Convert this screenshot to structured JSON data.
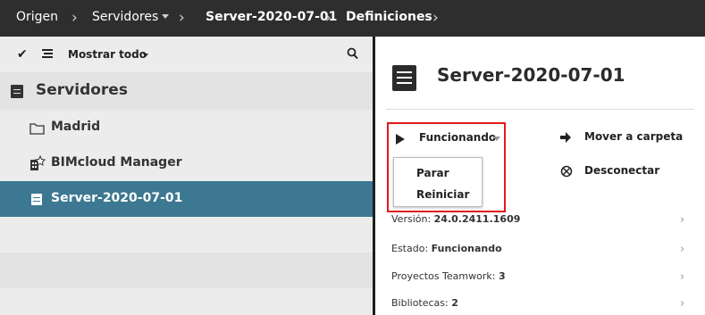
{
  "breadcrumb": {
    "items": [
      {
        "label": "Origen"
      },
      {
        "label": "Servidores"
      },
      {
        "label": "Server-2020-07-01"
      },
      {
        "label": "Definiciones"
      }
    ]
  },
  "sidebar": {
    "toolbar": {
      "filter_label": "Mostrar todo"
    },
    "group_title": "Servidores",
    "items": [
      {
        "label": "Madrid",
        "icon": "folder-icon"
      },
      {
        "label": "BIMcloud Manager",
        "icon": "bimcloud-manager-icon"
      },
      {
        "label": "Server-2020-07-01",
        "icon": "server-icon",
        "selected": true
      }
    ]
  },
  "detail": {
    "title": "Server-2020-07-01",
    "status_label": "Funcionando",
    "status_menu": [
      {
        "label": "Parar"
      },
      {
        "label": "Reiniciar"
      }
    ],
    "actions": [
      {
        "label": "Mover a carpeta",
        "icon": "arrow-right-icon"
      },
      {
        "label": "Desconectar",
        "icon": "disconnect-icon"
      }
    ],
    "info": [
      {
        "label": "Versión:",
        "value": "24.0.2411.1609"
      },
      {
        "label": "Estado:",
        "value": "Funcionando"
      },
      {
        "label": "Proyectos Teamwork:",
        "value": "3"
      },
      {
        "label": "Bibliotecas:",
        "value": "2"
      }
    ]
  },
  "colors": {
    "topbar": "#2e2e2e",
    "selection": "#3c7891",
    "highlight": "#e01a1a",
    "panel": "#ececec"
  }
}
